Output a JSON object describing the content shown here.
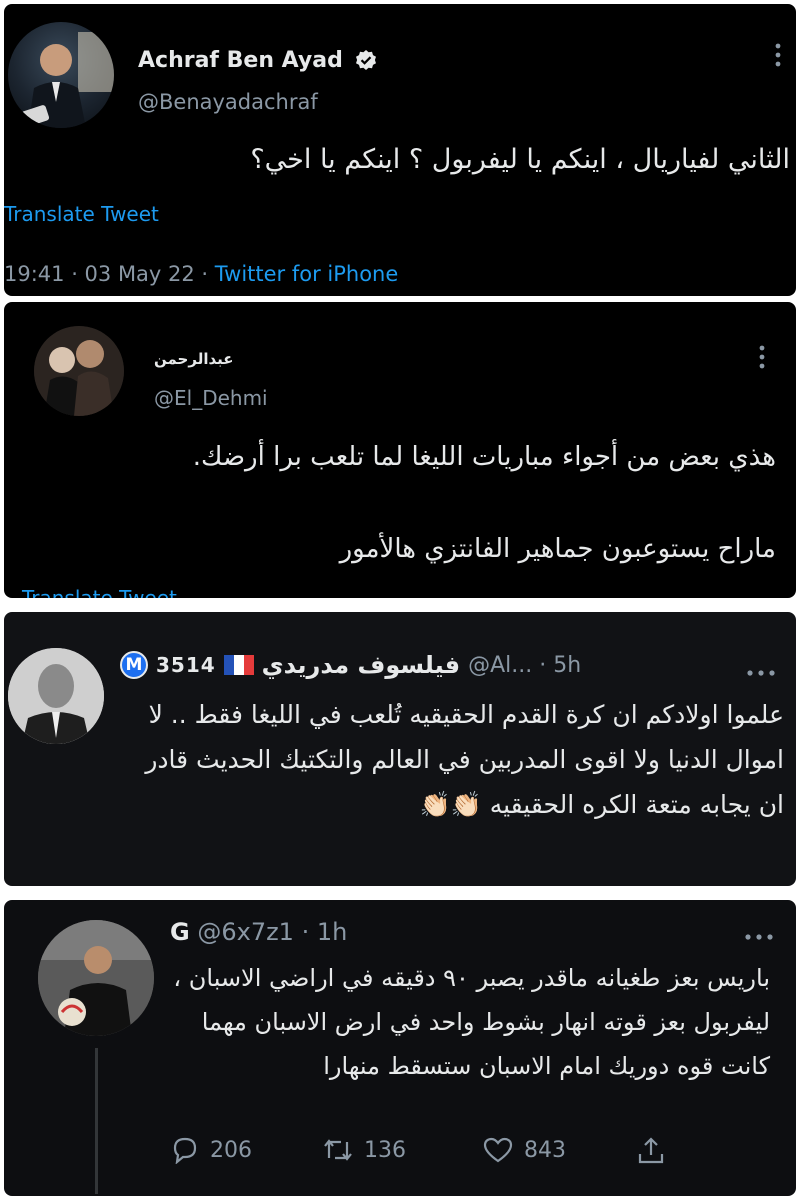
{
  "tweet1": {
    "name": "Achraf Ben Ayad",
    "handle": "@Benayadachraf",
    "text": "الثاني لفياريال ، اينكم يا ليفربول ؟ اينكم يا اخي؟",
    "translate": "Translate Tweet",
    "time": "19:41 · 03 May 22 ·",
    "source": "Twitter for iPhone",
    "more_icon": "more-vertical-icon",
    "verified_icon": "verified-badge-icon"
  },
  "tweet2": {
    "name": "عبدالرحمن",
    "handle": "@El_Dehmi",
    "line1": "هذي بعض من أجواء مباريات الليغا لما تلعب برا أرضك.",
    "line2": "ماراح يستوعبون جماهير الفانتزي هالأمور",
    "translate_partial": "Translate Tweet",
    "more_icon": "more-vertical-icon"
  },
  "tweet3": {
    "badge_m": "M",
    "badge_num": "3514",
    "flag_icon": "france-flag-icon",
    "name": "فيلسوف مدريدي",
    "handle_time": "@Al... · 5h",
    "text": "علموا اولادكم ان كرة القدم الحقيقيه تُلعب في الليغا فقط .. لا اموال الدنيا ولا اقوى المدربين في العالم والتكتيك الحديث قادر ان يجابه متعة الكره الحقيقيه",
    "emoji": "👏🏻👏🏻",
    "more_icon": "more-horizontal-icon"
  },
  "tweet4": {
    "name": "G",
    "handle_time": "@6x7z1 · 1h",
    "text": "باريس بعز طغيانه ماقدر يصبر ٩٠ دقيقه في اراضي الاسبان ، ليفربول بعز قوته انهار بشوط واحد في ارض الاسبان مهما كانت قوه دوريك امام الاسبان ستسقط منهارا",
    "replies": "206",
    "retweets": "136",
    "likes": "843",
    "more_icon": "more-horizontal-icon"
  }
}
